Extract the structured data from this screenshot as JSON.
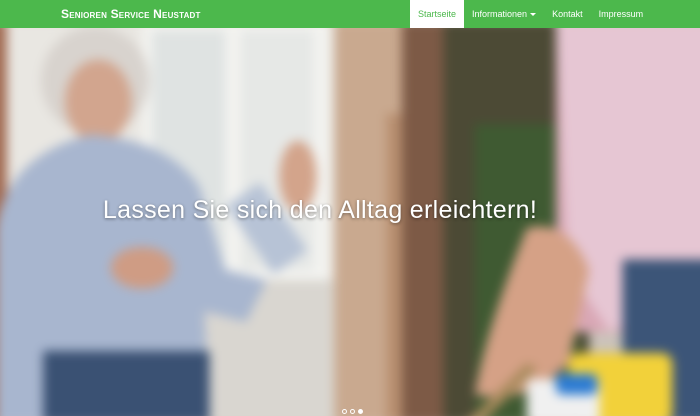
{
  "navbar": {
    "brand": "Senioren Service Neustadt",
    "items": [
      {
        "label": "Startseite",
        "active": true
      },
      {
        "label": "Informationen",
        "dropdown": true
      },
      {
        "label": "Kontakt"
      },
      {
        "label": "Impressum"
      }
    ]
  },
  "hero": {
    "headline": "Lassen Sie sich den Alltag erleichtern!",
    "slide_count": 3,
    "active_slide": 3
  },
  "colors": {
    "brand_green": "#4cb84c",
    "text_white": "#ffffff"
  },
  "icons": [
    "chevron-down-icon"
  ]
}
